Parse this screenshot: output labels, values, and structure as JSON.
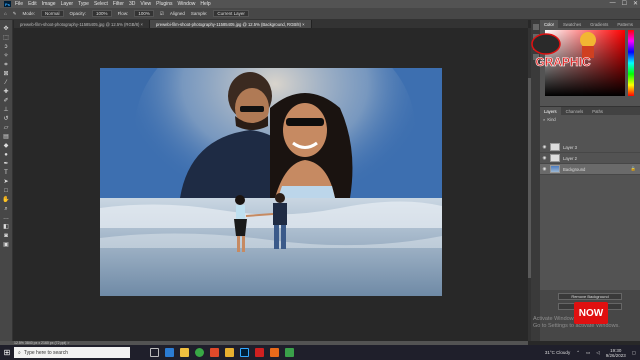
{
  "menubar": {
    "app_icon": "Ps",
    "items": [
      "File",
      "Edit",
      "Image",
      "Layer",
      "Type",
      "Select",
      "Filter",
      "3D",
      "View",
      "Plugins",
      "Window",
      "Help"
    ],
    "window_controls": [
      "—",
      "☐",
      "✕"
    ]
  },
  "options": {
    "mode_label": "Mode:",
    "mode_value": "Normal",
    "opacity_label": "Opacity:",
    "opacity_value": "100%",
    "flow_label": "Flow:",
    "flow_value": "100%",
    "aligned_label": "Aligned",
    "sample_label": "Sample:",
    "sample_value": "Current Layer"
  },
  "tabs": [
    {
      "label": "preweb-film-shoot-photography-11585405.jpg @ 12.5% (RGB/8) ×",
      "active": false
    },
    {
      "label": "prewebi-film-shoot-photography-11585405.jpg @ 12.5% (Background, RGB/8) ×",
      "active": true
    }
  ],
  "status": {
    "text": "12.5%    3840 px x 2160 px (72 ppi)   >"
  },
  "panel": {
    "top_tabs": [
      "Color",
      "Swatches",
      "Gradients",
      "Patterns"
    ],
    "layer_tabs": [
      "Layers",
      "Channels",
      "Paths"
    ],
    "kind_label": "Kind",
    "layers": [
      {
        "name": "Layer 3",
        "selected": false,
        "thumb": "plain"
      },
      {
        "name": "Layer 2",
        "selected": false,
        "thumb": "plain"
      },
      {
        "name": "Background",
        "selected": true,
        "thumb": "bg"
      }
    ],
    "properties_buttons": [
      "Remove Background",
      "Select"
    ]
  },
  "logo": {
    "text": "GRAPHIC"
  },
  "overlay": {
    "activate_line1": "Activate Windows",
    "activate_line2": "Go to Settings to activate Windows.",
    "now_badge": "NOW"
  },
  "taskbar": {
    "search_placeholder": "Type here to search",
    "weather": "31°C  Cloudy",
    "time": "19:30",
    "date": "9/26/2023"
  },
  "colors": {
    "accent": "#31a8ff",
    "badge": "#e01010"
  }
}
